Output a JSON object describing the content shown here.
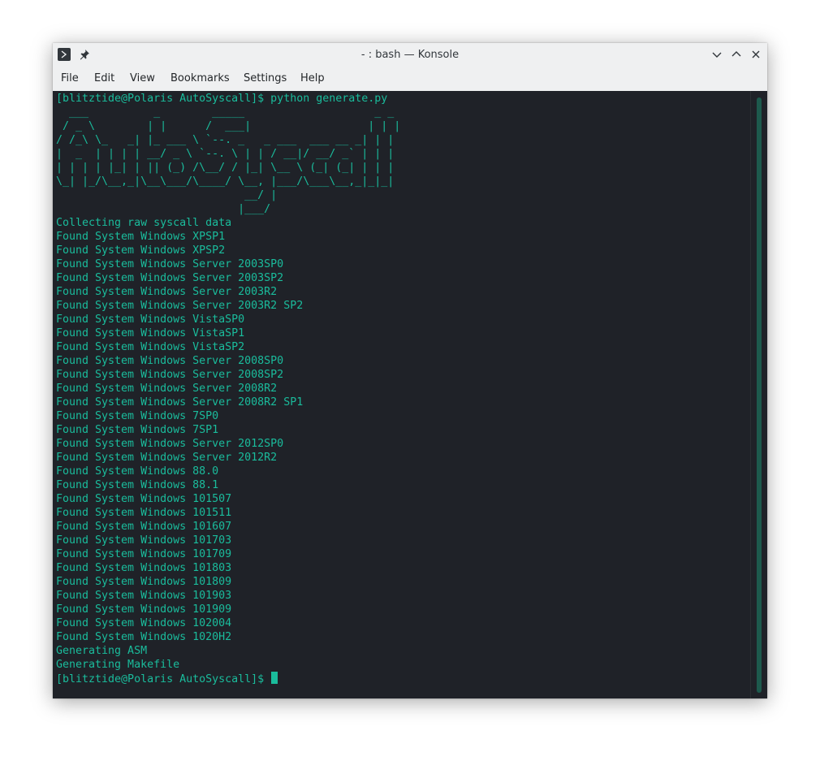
{
  "window": {
    "title": "- : bash — Konsole"
  },
  "titlebar": {
    "app_icon": "terminal-prompt-icon",
    "pin_icon": "pin-icon",
    "buttons": [
      "minimize-icon",
      "maximize-icon",
      "close-icon"
    ]
  },
  "menu": {
    "file": "File",
    "edit": "Edit",
    "view": "View",
    "bookmarks": "Bookmarks",
    "settings": "Settings",
    "help": "Help"
  },
  "colors": {
    "terminal_bg": "#1f2228",
    "terminal_fg": "#1abc9c",
    "scroll_thumb": "#1d5a4d",
    "chrome_bg": "#eff0f1"
  },
  "terminal": {
    "lines": [
      "[blitztide@Polaris AutoSyscall]$ python generate.py",
      "  ___          _        _____                    _ _",
      " / _ \\        | |      /  ___|                  | | |",
      "/ /_\\ \\_   _| |_ ___ \\ `--. _   _ ___  ___ __ _| | |",
      "|  _  | | | | __/ _ \\ `--. \\ | | / __|/ __/ _` | | |",
      "| | | | |_| | || (_) /\\__/ / |_| \\__ \\ (_| (_| | | |",
      "\\_| |_/\\__,_|\\__\\___/\\____/ \\__, |___/\\___\\__,_|_|_|",
      "                             __/ |",
      "                            |___/",
      "Collecting raw syscall data",
      "Found System Windows XPSP1",
      "Found System Windows XPSP2",
      "Found System Windows Server 2003SP0",
      "Found System Windows Server 2003SP2",
      "Found System Windows Server 2003R2",
      "Found System Windows Server 2003R2 SP2",
      "Found System Windows VistaSP0",
      "Found System Windows VistaSP1",
      "Found System Windows VistaSP2",
      "Found System Windows Server 2008SP0",
      "Found System Windows Server 2008SP2",
      "Found System Windows Server 2008R2",
      "Found System Windows Server 2008R2 SP1",
      "Found System Windows 7SP0",
      "Found System Windows 7SP1",
      "Found System Windows Server 2012SP0",
      "Found System Windows Server 2012R2",
      "Found System Windows 88.0",
      "Found System Windows 88.1",
      "Found System Windows 101507",
      "Found System Windows 101511",
      "Found System Windows 101607",
      "Found System Windows 101703",
      "Found System Windows 101709",
      "Found System Windows 101803",
      "Found System Windows 101809",
      "Found System Windows 101903",
      "Found System Windows 101909",
      "Found System Windows 102004",
      "Found System Windows 1020H2",
      "Generating ASM",
      "Generating Makefile"
    ],
    "prompt": "[blitztide@Polaris AutoSyscall]$ "
  }
}
